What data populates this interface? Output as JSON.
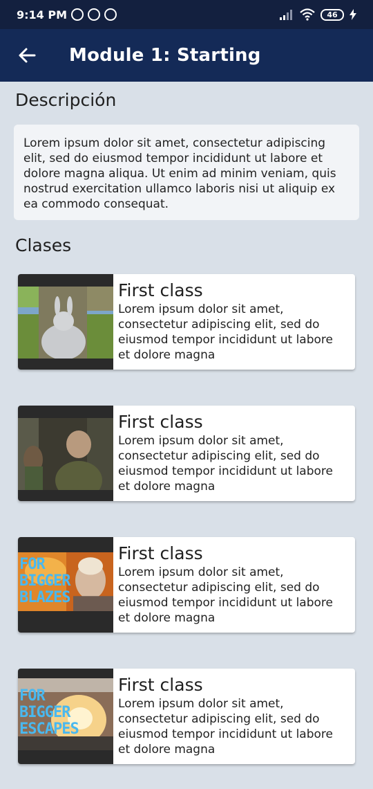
{
  "status_bar": {
    "time": "9:14 PM",
    "battery": "46"
  },
  "app_bar": {
    "title": "Module 1: Starting"
  },
  "description": {
    "heading": "Descripción",
    "text": "Lorem ipsum dolor sit amet, consectetur adipiscing elit, sed do eiusmod tempor incididunt ut labore et dolore magna aliqua. Ut enim ad minim veniam, quis nostrud exercitation ullamco laboris nisi ut aliquip ex ea commodo consequat."
  },
  "classes": {
    "heading": "Clases",
    "items": [
      {
        "title": "First class",
        "text": "Lorem ipsum dolor sit amet, consectetur adipiscing elit, sed do eiusmod tempor incididunt ut labore et dolore magna"
      },
      {
        "title": "First class",
        "text": "Lorem ipsum dolor sit amet, consectetur adipiscing elit, sed do eiusmod tempor incididunt ut labore et dolore magna"
      },
      {
        "title": "First class",
        "text": "Lorem ipsum dolor sit amet, consectetur adipiscing elit, sed do eiusmod tempor incididunt ut labore et dolore magna",
        "overlay": [
          "FOR",
          "BIGGER",
          "BLAZES"
        ]
      },
      {
        "title": "First class",
        "text": "Lorem ipsum dolor sit amet, consectetur adipiscing elit, sed do eiusmod tempor incididunt ut labore et dolore magna",
        "overlay": [
          "FOR",
          "BIGGER",
          "ESCAPES"
        ]
      }
    ]
  },
  "colors": {
    "status_bar": "#13203f",
    "app_bar": "#142a57",
    "background": "#d9e0e8",
    "overlay_text": "#49b8ef"
  }
}
